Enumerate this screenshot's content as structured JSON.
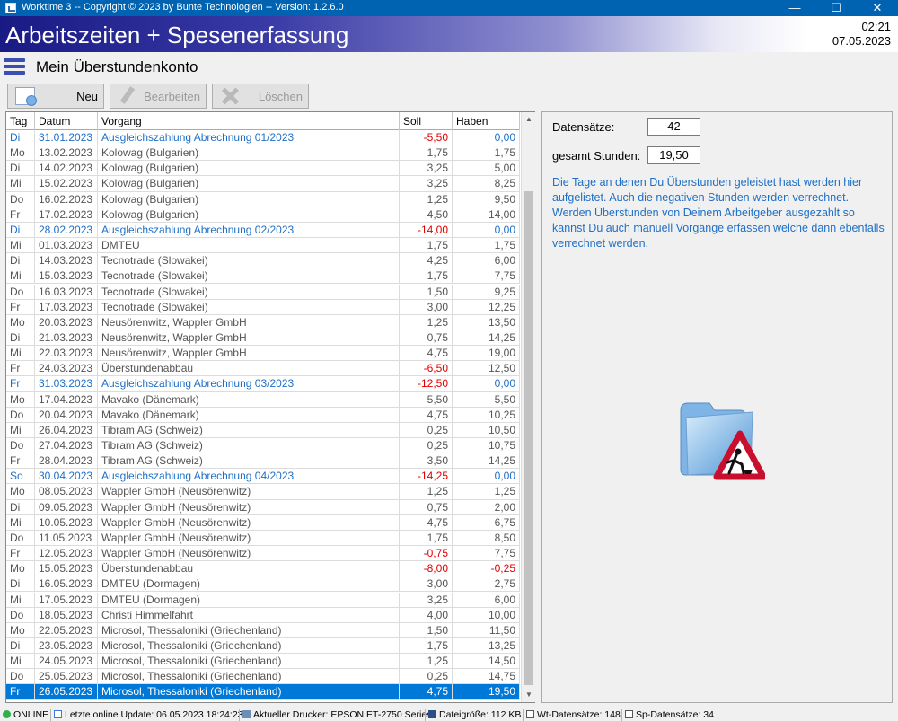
{
  "window": {
    "title": "Worktime 3 -- Copyright © 2023 by Bunte Technologien -- Version: 1.2.6.0"
  },
  "banner": {
    "title": "Arbeitszeiten + Spesenerfassung",
    "time": "02:21",
    "date": "07.05.2023"
  },
  "page": {
    "title": "Mein Überstundenkonto"
  },
  "toolbar": {
    "new_label": "Neu",
    "edit_label": "Bearbeiten",
    "delete_label": "Löschen"
  },
  "table": {
    "headers": {
      "tag": "Tag",
      "datum": "Datum",
      "vorgang": "Vorgang",
      "soll": "Soll",
      "haben": "Haben"
    },
    "rows": [
      {
        "tag": "Di",
        "datum": "31.01.2023",
        "vorgang": "Ausgleichszahlung Abrechnung 01/2023",
        "soll": "-5,50",
        "haben": "0,00",
        "hl": true
      },
      {
        "tag": "Mo",
        "datum": "13.02.2023",
        "vorgang": "Kolowag (Bulgarien)",
        "soll": "1,75",
        "haben": "1,75"
      },
      {
        "tag": "Di",
        "datum": "14.02.2023",
        "vorgang": "Kolowag (Bulgarien)",
        "soll": "3,25",
        "haben": "5,00"
      },
      {
        "tag": "Mi",
        "datum": "15.02.2023",
        "vorgang": "Kolowag (Bulgarien)",
        "soll": "3,25",
        "haben": "8,25"
      },
      {
        "tag": "Do",
        "datum": "16.02.2023",
        "vorgang": "Kolowag (Bulgarien)",
        "soll": "1,25",
        "haben": "9,50"
      },
      {
        "tag": "Fr",
        "datum": "17.02.2023",
        "vorgang": "Kolowag (Bulgarien)",
        "soll": "4,50",
        "haben": "14,00"
      },
      {
        "tag": "Di",
        "datum": "28.02.2023",
        "vorgang": "Ausgleichszahlung Abrechnung 02/2023",
        "soll": "-14,00",
        "haben": "0,00",
        "hl": true
      },
      {
        "tag": "Mi",
        "datum": "01.03.2023",
        "vorgang": "DMTEU",
        "soll": "1,75",
        "haben": "1,75"
      },
      {
        "tag": "Di",
        "datum": "14.03.2023",
        "vorgang": "Tecnotrade (Slowakei)",
        "soll": "4,25",
        "haben": "6,00"
      },
      {
        "tag": "Mi",
        "datum": "15.03.2023",
        "vorgang": "Tecnotrade (Slowakei)",
        "soll": "1,75",
        "haben": "7,75"
      },
      {
        "tag": "Do",
        "datum": "16.03.2023",
        "vorgang": "Tecnotrade (Slowakei)",
        "soll": "1,50",
        "haben": "9,25"
      },
      {
        "tag": "Fr",
        "datum": "17.03.2023",
        "vorgang": "Tecnotrade (Slowakei)",
        "soll": "3,00",
        "haben": "12,25"
      },
      {
        "tag": "Mo",
        "datum": "20.03.2023",
        "vorgang": "Neusörenwitz, Wappler GmbH",
        "soll": "1,25",
        "haben": "13,50"
      },
      {
        "tag": "Di",
        "datum": "21.03.2023",
        "vorgang": "Neusörenwitz, Wappler GmbH",
        "soll": "0,75",
        "haben": "14,25"
      },
      {
        "tag": "Mi",
        "datum": "22.03.2023",
        "vorgang": "Neusörenwitz, Wappler GmbH",
        "soll": "4,75",
        "haben": "19,00"
      },
      {
        "tag": "Fr",
        "datum": "24.03.2023",
        "vorgang": "Überstundenabbau",
        "soll": "-6,50",
        "haben": "12,50"
      },
      {
        "tag": "Fr",
        "datum": "31.03.2023",
        "vorgang": "Ausgleichszahlung Abrechnung 03/2023",
        "soll": "-12,50",
        "haben": "0,00",
        "hl": true
      },
      {
        "tag": "Mo",
        "datum": "17.04.2023",
        "vorgang": "Mavako (Dänemark)",
        "soll": "5,50",
        "haben": "5,50"
      },
      {
        "tag": "Do",
        "datum": "20.04.2023",
        "vorgang": "Mavako (Dänemark)",
        "soll": "4,75",
        "haben": "10,25"
      },
      {
        "tag": "Mi",
        "datum": "26.04.2023",
        "vorgang": "Tibram AG (Schweiz)",
        "soll": "0,25",
        "haben": "10,50"
      },
      {
        "tag": "Do",
        "datum": "27.04.2023",
        "vorgang": "Tibram AG (Schweiz)",
        "soll": "0,25",
        "haben": "10,75"
      },
      {
        "tag": "Fr",
        "datum": "28.04.2023",
        "vorgang": "Tibram AG (Schweiz)",
        "soll": "3,50",
        "haben": "14,25"
      },
      {
        "tag": "So",
        "datum": "30.04.2023",
        "vorgang": "Ausgleichszahlung Abrechnung 04/2023",
        "soll": "-14,25",
        "haben": "0,00",
        "hl": true
      },
      {
        "tag": "Mo",
        "datum": "08.05.2023",
        "vorgang": "Wappler GmbH (Neusörenwitz)",
        "soll": "1,25",
        "haben": "1,25"
      },
      {
        "tag": "Di",
        "datum": "09.05.2023",
        "vorgang": "Wappler GmbH (Neusörenwitz)",
        "soll": "0,75",
        "haben": "2,00"
      },
      {
        "tag": "Mi",
        "datum": "10.05.2023",
        "vorgang": "Wappler GmbH (Neusörenwitz)",
        "soll": "4,75",
        "haben": "6,75"
      },
      {
        "tag": "Do",
        "datum": "11.05.2023",
        "vorgang": "Wappler GmbH (Neusörenwitz)",
        "soll": "1,75",
        "haben": "8,50"
      },
      {
        "tag": "Fr",
        "datum": "12.05.2023",
        "vorgang": "Wappler GmbH (Neusörenwitz)",
        "soll": "-0,75",
        "haben": "7,75"
      },
      {
        "tag": "Mo",
        "datum": "15.05.2023",
        "vorgang": "Überstundenabbau",
        "soll": "-8,00",
        "haben": "-0,25"
      },
      {
        "tag": "Di",
        "datum": "16.05.2023",
        "vorgang": "DMTEU (Dormagen)",
        "soll": "3,00",
        "haben": "2,75"
      },
      {
        "tag": "Mi",
        "datum": "17.05.2023",
        "vorgang": "DMTEU (Dormagen)",
        "soll": "3,25",
        "haben": "6,00"
      },
      {
        "tag": "Do",
        "datum": "18.05.2023",
        "vorgang": "Christi Himmelfahrt",
        "soll": "4,00",
        "haben": "10,00"
      },
      {
        "tag": "Mo",
        "datum": "22.05.2023",
        "vorgang": "Microsol, Thessaloniki (Griechenland)",
        "soll": "1,50",
        "haben": "11,50"
      },
      {
        "tag": "Di",
        "datum": "23.05.2023",
        "vorgang": "Microsol, Thessaloniki (Griechenland)",
        "soll": "1,75",
        "haben": "13,25"
      },
      {
        "tag": "Mi",
        "datum": "24.05.2023",
        "vorgang": "Microsol, Thessaloniki (Griechenland)",
        "soll": "1,25",
        "haben": "14,50"
      },
      {
        "tag": "Do",
        "datum": "25.05.2023",
        "vorgang": "Microsol, Thessaloniki (Griechenland)",
        "soll": "0,25",
        "haben": "14,75"
      },
      {
        "tag": "Fr",
        "datum": "26.05.2023",
        "vorgang": "Microsol, Thessaloniki (Griechenland)",
        "soll": "4,75",
        "haben": "19,50",
        "selected": true
      }
    ]
  },
  "info": {
    "records_label": "Datensätze:",
    "records_value": "42",
    "hours_label": "gesamt Stunden:",
    "hours_value": "19,50",
    "description": "Die Tage an denen Du Überstunden geleistet hast werden hier aufgelistet. Auch die negativen Stunden werden verrechnet. Werden Überstunden von Deinem Arbeitgeber ausgezahlt so kannst Du auch manuell Vorgänge erfassen welche dann ebenfalls verrechnet werden."
  },
  "status": {
    "online": "ONLINE",
    "last_update": "Letzte online Update: 06.05.2023 18:24:23",
    "printer": "Aktueller Drucker: EPSON ET-2750 Series",
    "filesize": "Dateigröße: 112 KB",
    "wt_records": "Wt-Datensätze: 148",
    "sp_records": "Sp-Datensätze: 34"
  },
  "colors": {
    "titlebar": "#0063b1",
    "highlight_text": "#1f6fc6",
    "negative": "#e00000",
    "selection": "#0078d7"
  }
}
